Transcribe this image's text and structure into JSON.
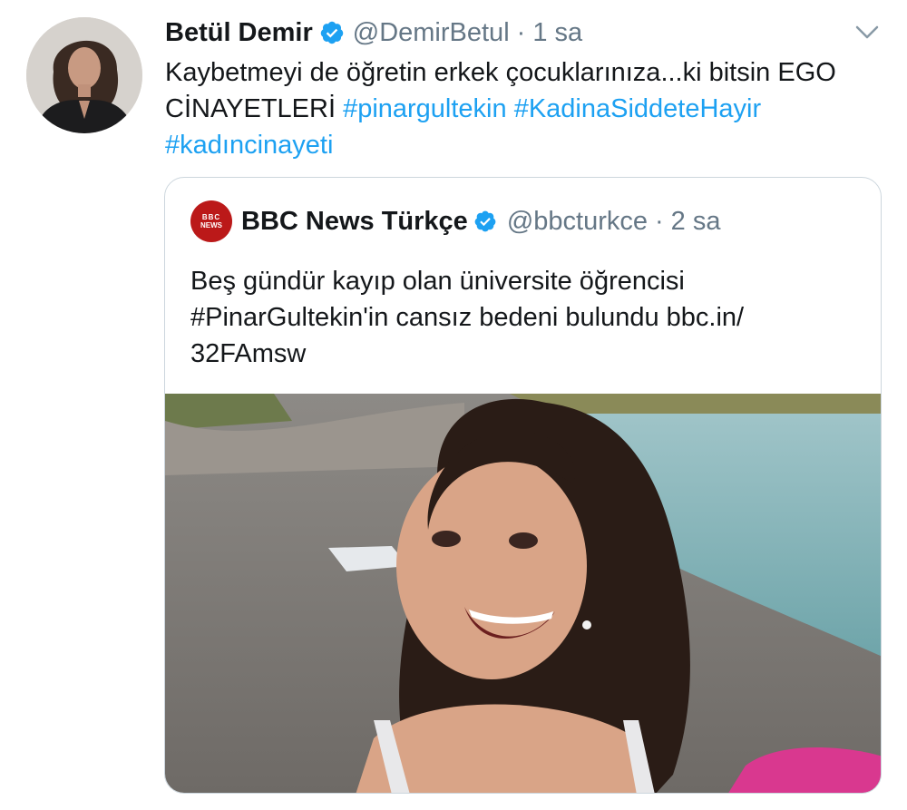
{
  "tweet": {
    "author_name": "Betül Demir",
    "author_handle": "@DemirBetul",
    "separator": "·",
    "time": "1 sa",
    "text_lines": [
      "Kaybetmeyi de öğretin erkek çocuklarınıza...ki bitsin EGO"
    ],
    "text_line2_prefix": "CİNAYETLERİ ",
    "hashtags": [
      "#pinargultekin",
      "#KadinaSiddeteHayir",
      "#kadıncinayeti"
    ]
  },
  "quoted_tweet": {
    "logo_top": "BBC",
    "logo_bottom": "NEWS",
    "author_name": "BBC News Türkçe",
    "author_handle": "@bbcturkce",
    "separator": "·",
    "time": "2 sa",
    "text_lines": [
      "Beş gündür kayıp olan üniversite öğrencisi",
      "#PinarGultekin'in cansız bedeni bulundu bbc.in/",
      "32FAmsw"
    ]
  },
  "icons": {
    "verified": "verified-badge-icon",
    "menu": "chevron-down-icon"
  },
  "colors": {
    "link": "#1da1f2",
    "verified": "#1da1f2",
    "secondary_text": "#657786",
    "bbc_red": "#bb1919"
  }
}
